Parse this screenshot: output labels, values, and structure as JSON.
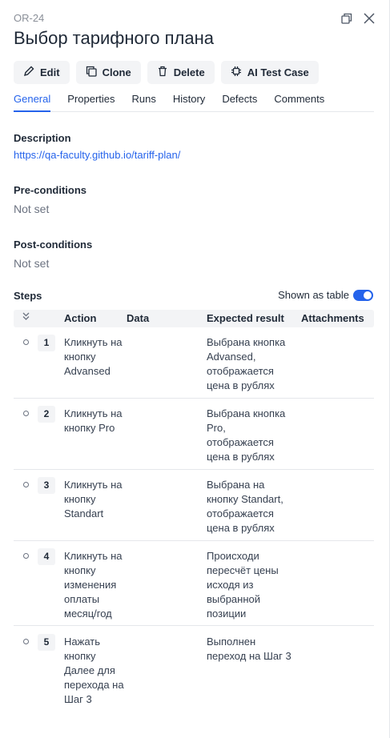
{
  "header": {
    "case_id": "OR-24",
    "title": "Выбор тарифного плана"
  },
  "toolbar": {
    "edit": "Edit",
    "clone": "Clone",
    "delete": "Delete",
    "ai": "AI Test Case"
  },
  "tabs": [
    "General",
    "Properties",
    "Runs",
    "History",
    "Defects",
    "Comments"
  ],
  "description": {
    "label": "Description",
    "link": "https://qa-faculty.github.io/tariff-plan/"
  },
  "preconditions": {
    "label": "Pre-conditions",
    "value": "Not set"
  },
  "postconditions": {
    "label": "Post-conditions",
    "value": "Not set"
  },
  "steps": {
    "label": "Steps",
    "toggle_label": "Shown as table",
    "columns": [
      "Action",
      "Data",
      "Expected result",
      "Attachments"
    ],
    "rows": [
      {
        "num": "1",
        "action": "Кликнуть на кнопку Advansed",
        "data": "",
        "expected": "Выбрана кнопка Advansed, отображается цена в рублях"
      },
      {
        "num": "2",
        "action": "Кликнуть на кнопку Pro",
        "data": "",
        "expected": "Выбрана кнопка Pro, отображается цена в рублях"
      },
      {
        "num": "3",
        "action": "Кликнуть на кнопку Standart",
        "data": "",
        "expected": "Выбрана на кнопку Standart, отображается цена в рублях"
      },
      {
        "num": "4",
        "action": "Кликнуть на кнопку изменения оплаты месяц/год",
        "data": "",
        "expected": "Происходи пересчёт цены исходя из выбранной позиции"
      },
      {
        "num": "5",
        "action": "Нажать кнопку Далее для перехода на Шаг 3",
        "data": "",
        "expected": "Выполнен переход на Шаг 3"
      }
    ]
  },
  "colors": {
    "accent": "#2563eb",
    "muted": "#6b7280"
  }
}
